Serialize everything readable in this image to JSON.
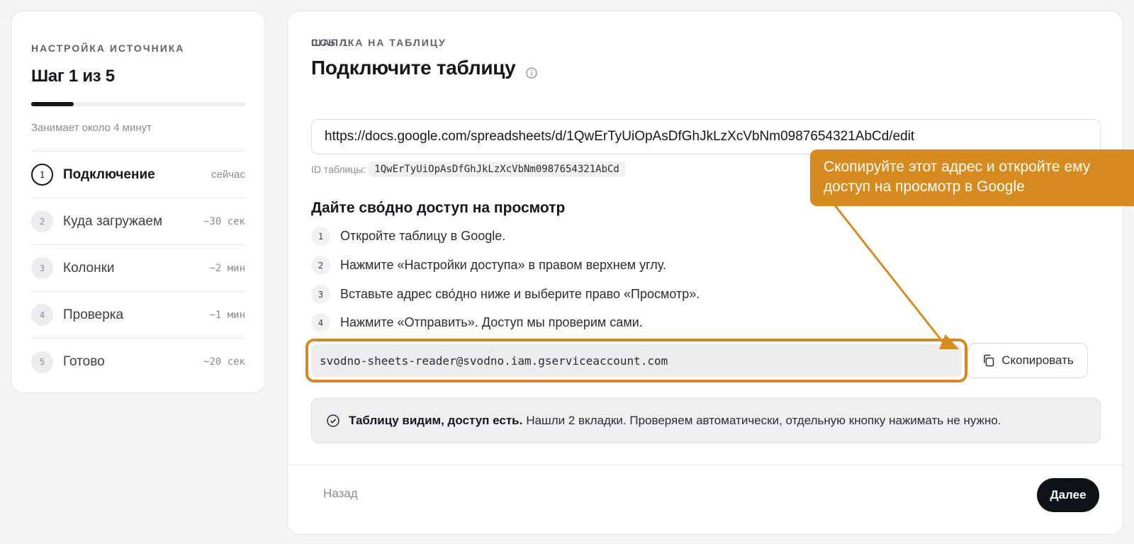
{
  "sidebar": {
    "eyebrow": "НАСТРОЙКА ИСТОЧНИКА",
    "title": "Шаг 1 из 5",
    "progress_fraction": 0.2,
    "duration": "Занимает около 4 минут",
    "steps": [
      {
        "num": "1",
        "label": "Подключение",
        "time": "сейчас",
        "active": true
      },
      {
        "num": "2",
        "label": "Куда загружаем",
        "time": "~30 сек"
      },
      {
        "num": "3",
        "label": "Колонки",
        "time": "~2 мин"
      },
      {
        "num": "4",
        "label": "Проверка",
        "time": "~1 мин"
      },
      {
        "num": "5",
        "label": "Готово",
        "time": "~20 сек"
      }
    ]
  },
  "main": {
    "eyebrow": "ШАГ 1",
    "title": "Подключите таблицу",
    "info_icon": "info-icon",
    "url_label": "ССЫЛКА НА ТАБЛИЦУ",
    "url_value": "https://docs.google.com/spreadsheets/d/1QwErTyUiOpAsDfGhJkLzXcVbNm0987654321AbCd/edit",
    "id_label": "ID таблицы:",
    "id_value": "1QwErTyUiOpAsDfGhJkLzXcVbNm0987654321AbCd",
    "section_title": "Дайте сво́дно доступ на просмотр",
    "instructions": [
      {
        "num": "1",
        "text": "Откройте таблицу в Google."
      },
      {
        "num": "2",
        "text": "Нажмите «Настройки доступа» в правом верхнем углу."
      },
      {
        "num": "3",
        "text": "Вставьте адрес сво́дно ниже и выберите право «Просмотр»."
      },
      {
        "num": "4",
        "text": "Нажмите «Отправить». Доступ мы проверим сами."
      }
    ],
    "service_email": "svodno-sheets-reader@svodno.iam.gserviceaccount.com",
    "copy_label": "Скопировать",
    "status_bold": "Таблицу видим, доступ есть.",
    "status_text": "Нашли 2 вкладки. Проверяем автоматически, отдельную кнопку нажимать не нужно.",
    "back_label": "Назад",
    "next_label": "Далее"
  },
  "callout": {
    "text": "Скопируйте этот адрес и откройте ему доступ на просмотр в Google",
    "color": "#d68a20"
  },
  "colors": {
    "accent_dark": "#0f1219",
    "highlight": "#d38a23",
    "background": "#f4f4f6"
  }
}
